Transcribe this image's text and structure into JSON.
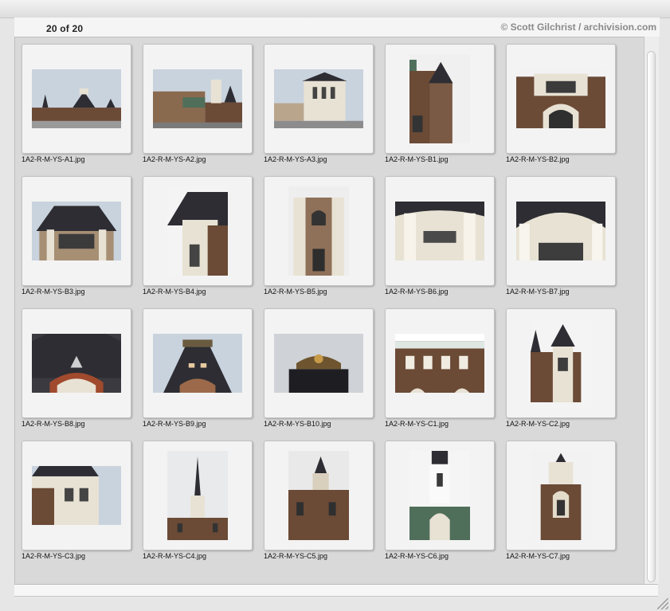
{
  "header": {
    "count": "20 of 20",
    "credit": "© Scott Gilchrist / archivision.com"
  },
  "thumbnails": [
    {
      "filename": "1A2-R-M-YS-A1.jpg",
      "orientation": "landscape",
      "subject": "station-panorama"
    },
    {
      "filename": "1A2-R-M-YS-A2.jpg",
      "orientation": "landscape",
      "subject": "station-street"
    },
    {
      "filename": "1A2-R-M-YS-A3.jpg",
      "orientation": "landscape",
      "subject": "station-square"
    },
    {
      "filename": "1A2-R-M-YS-B1.jpg",
      "orientation": "portrait",
      "subject": "tower-corner"
    },
    {
      "filename": "1A2-R-M-YS-B2.jpg",
      "orientation": "landscape",
      "subject": "facade-arch"
    },
    {
      "filename": "1A2-R-M-YS-B3.jpg",
      "orientation": "landscape",
      "subject": "facade-roof"
    },
    {
      "filename": "1A2-R-M-YS-B4.jpg",
      "orientation": "portrait",
      "subject": "roof-detail"
    },
    {
      "filename": "1A2-R-M-YS-B5.jpg",
      "orientation": "portrait",
      "subject": "column-tower"
    },
    {
      "filename": "1A2-R-M-YS-B6.jpg",
      "orientation": "landscape",
      "subject": "columns-cornice"
    },
    {
      "filename": "1A2-R-M-YS-B7.jpg",
      "orientation": "landscape",
      "subject": "arch-detail"
    },
    {
      "filename": "1A2-R-M-YS-B8.jpg",
      "orientation": "landscape",
      "subject": "dark-roof-arch"
    },
    {
      "filename": "1A2-R-M-YS-B9.jpg",
      "orientation": "landscape",
      "subject": "roof-crown"
    },
    {
      "filename": "1A2-R-M-YS-B10.jpg",
      "orientation": "landscape",
      "subject": "crown-sky"
    },
    {
      "filename": "1A2-R-M-YS-C1.jpg",
      "orientation": "landscape",
      "subject": "sign-windows"
    },
    {
      "filename": "1A2-R-M-YS-C2.jpg",
      "orientation": "portrait",
      "subject": "spires-building"
    },
    {
      "filename": "1A2-R-M-YS-C3.jpg",
      "orientation": "landscape",
      "subject": "side-wing"
    },
    {
      "filename": "1A2-R-M-YS-C4.jpg",
      "orientation": "portrait",
      "subject": "spire-tall"
    },
    {
      "filename": "1A2-R-M-YS-C5.jpg",
      "orientation": "portrait",
      "subject": "tower-brick"
    },
    {
      "filename": "1A2-R-M-YS-C6.jpg",
      "orientation": "portrait",
      "subject": "white-tower"
    },
    {
      "filename": "1A2-R-M-YS-C7.jpg",
      "orientation": "portrait",
      "subject": "gable-tower"
    }
  ],
  "colors": {
    "sky": "#c9d3de",
    "brick": "#6b4a36",
    "roof": "#2d2d33",
    "stone": "#e8e2d4",
    "green": "#4f6f5a"
  }
}
